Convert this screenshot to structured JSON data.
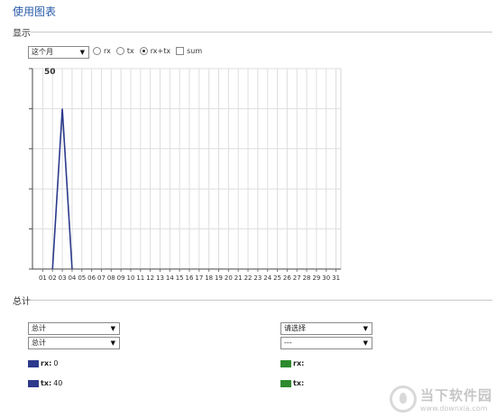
{
  "page_title": "使用图表",
  "display_section": {
    "legend": "显示",
    "period_select": {
      "value": "这个月"
    },
    "options": [
      {
        "label": "rx",
        "type": "radio",
        "selected": false
      },
      {
        "label": "tx",
        "type": "radio",
        "selected": false
      },
      {
        "label": "rx+tx",
        "type": "radio",
        "selected": true
      },
      {
        "label": "sum",
        "type": "checkbox",
        "checked": false
      }
    ]
  },
  "chart_data": {
    "type": "line",
    "categories": [
      "01",
      "02",
      "03",
      "04",
      "05",
      "06",
      "07",
      "08",
      "09",
      "10",
      "11",
      "12",
      "13",
      "14",
      "15",
      "16",
      "17",
      "18",
      "19",
      "20",
      "21",
      "22",
      "23",
      "24",
      "25",
      "26",
      "27",
      "28",
      "29",
      "30",
      "31"
    ],
    "series": [
      {
        "values": [
          null,
          0,
          40,
          0,
          null,
          null,
          null,
          null,
          null,
          null,
          null,
          null,
          null,
          null,
          null,
          null,
          null,
          null,
          null,
          null,
          null,
          null,
          null,
          null,
          null,
          null,
          null,
          null,
          null,
          null,
          null
        ]
      }
    ],
    "y_tick_label": "50",
    "ylim": [
      0,
      50
    ],
    "grid": true,
    "line_color": "#2b3a8c"
  },
  "totals_section": {
    "legend": "总计",
    "left": {
      "select1": "总计",
      "select2": "总计",
      "rx_label": "rx:",
      "rx_value": "0",
      "tx_label": "tx:",
      "tx_value": "40",
      "color": "#2d3a8c"
    },
    "right": {
      "select1": "请选择",
      "select2": "---",
      "rx_label": "rx:",
      "tx_label": "tx:",
      "color": "#2e8a2e"
    }
  },
  "watermark": {
    "text": "当下软件园",
    "url": "www.downxia.com"
  }
}
